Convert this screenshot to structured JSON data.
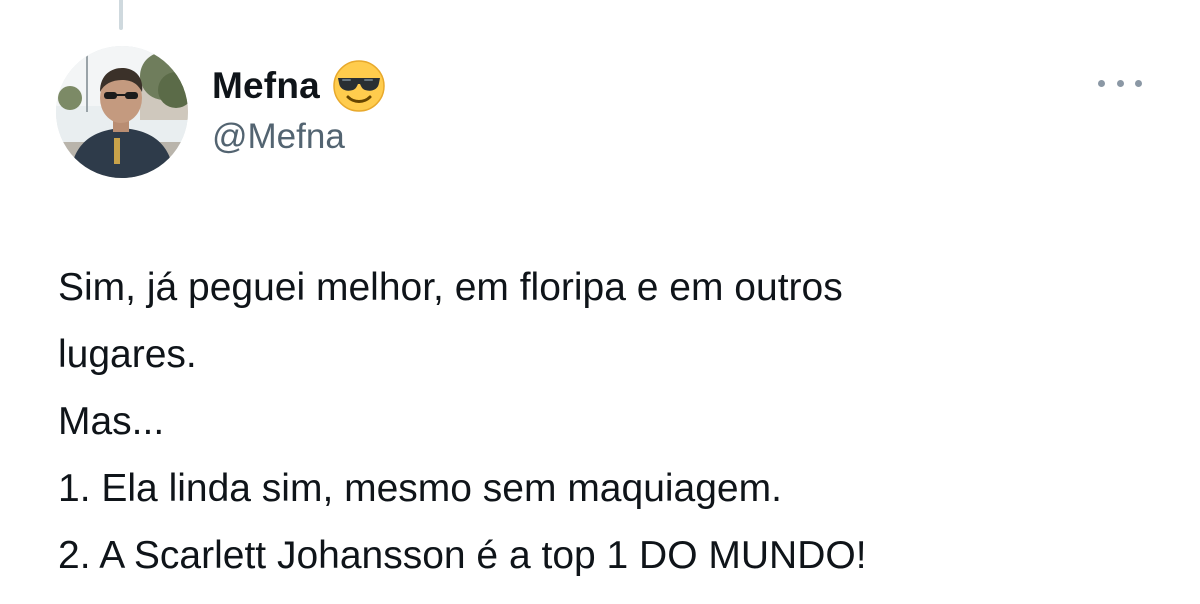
{
  "author": {
    "display_name": "Mefna",
    "handle": "@Mefna",
    "name_emoji": "smiling-face-with-sunglasses-emoji",
    "avatar": "profile-photo-avatar"
  },
  "actions": {
    "more_icon": "more-horizontal-icon"
  },
  "tweet": {
    "lines": [
      "Sim, já peguei melhor, em floripa e em outros",
      "lugares.",
      "Mas...",
      "1. Ela linda sim, mesmo sem maquiagem.",
      "2. A Scarlett Johansson é a top 1 DO MUNDO!"
    ]
  },
  "colors": {
    "text": "#0f1419",
    "secondary_text": "#536471",
    "thread_line": "#cfd9de",
    "icon": "#8b98a5",
    "background": "#ffffff"
  }
}
